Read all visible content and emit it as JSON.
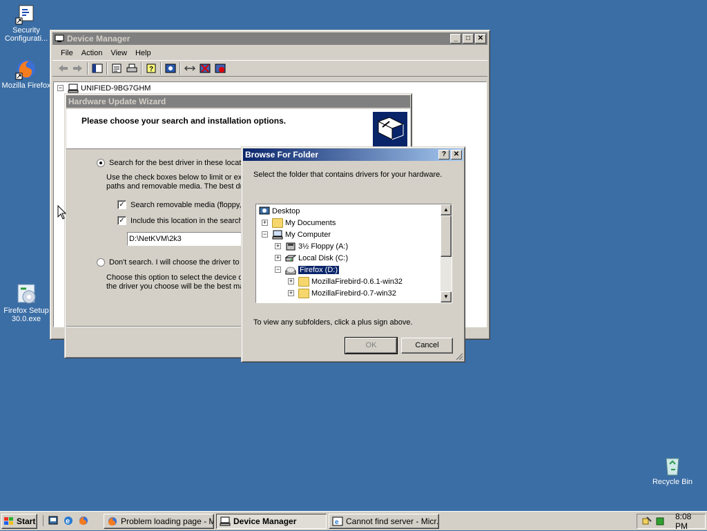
{
  "desktop": {
    "icons": [
      {
        "label": "Security Configurati..."
      },
      {
        "label": "Mozilla Firefox"
      },
      {
        "label": "Firefox Setup 30.0.exe"
      },
      {
        "label": "Recycle Bin"
      }
    ]
  },
  "device_manager": {
    "title": "Device Manager",
    "menu": [
      "File",
      "Action",
      "View",
      "Help"
    ],
    "tree_root": "UNIFIED-9BG7GHM"
  },
  "wizard": {
    "title": "Hardware Update Wizard",
    "heading": "Please choose your search and installation options.",
    "option1": "Search for the best driver in these locatio",
    "option1_desc_line1": "Use the check boxes below to limit or exp",
    "option1_desc_line2": "paths and removable media. The best driv",
    "check1": "Search removable media (floppy, C",
    "check2": "Include this location in the search:",
    "path_value": "D:\\NetKVM\\2k3",
    "option2": "Don't search. I will choose the driver to in",
    "option2_desc_line1": "Choose this option to select the device dr",
    "option2_desc_line2": "the driver you choose will be the best mat"
  },
  "browse": {
    "title": "Browse For Folder",
    "help_btn": "?",
    "close_btn": "✕",
    "instruction": "Select the folder that contains drivers for your hardware.",
    "tree": [
      {
        "label": "Desktop"
      },
      {
        "label": "My Documents"
      },
      {
        "label": "My Computer"
      },
      {
        "label": "3½ Floppy (A:)"
      },
      {
        "label": "Local Disk (C:)"
      },
      {
        "label": "Firefox (D:)"
      },
      {
        "label": "MozillaFirebird-0.6.1-win32"
      },
      {
        "label": "MozillaFirebird-0.7-win32"
      }
    ],
    "hint": "To view any subfolders, click a plus sign above.",
    "ok": "OK",
    "cancel": "Cancel"
  },
  "taskbar": {
    "start": "Start",
    "tasks": [
      {
        "label": "Problem loading page - M..."
      },
      {
        "label": "Device Manager"
      },
      {
        "label": "Cannot find server - Micr..."
      }
    ],
    "clock": "8:08 PM"
  },
  "colors": {
    "desktop": "#3a6ea5",
    "title_active": "#0a246a",
    "title_inactive": "#808080",
    "face": "#d4d0c8",
    "selection": "#0a246a"
  }
}
